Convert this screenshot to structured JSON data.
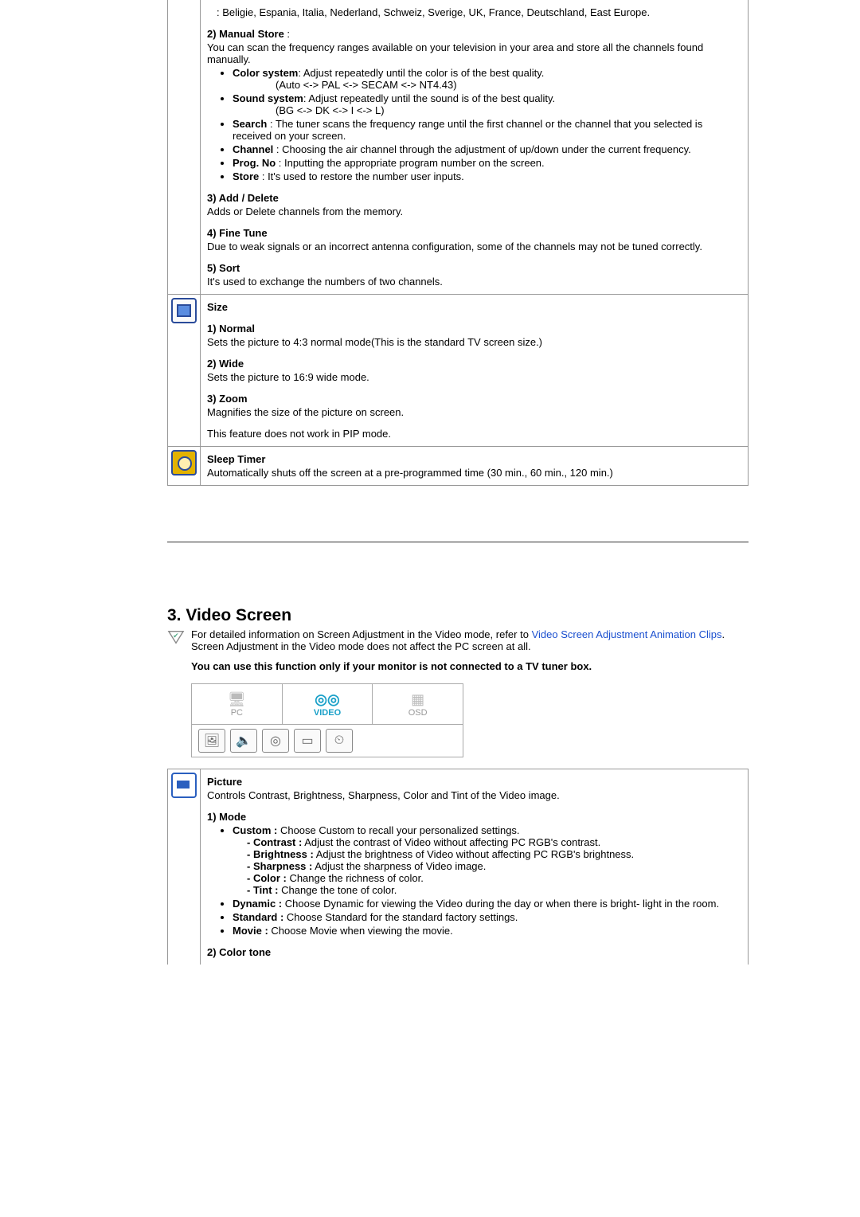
{
  "countries_line": ": Beligie, Espania, Italia, Nederland, Schweiz, Sverige, UK, France, Deutschland, East Europe.",
  "manual_store": {
    "title": "2) Manual Store",
    "colon": " :",
    "desc": "You can scan the frequency ranges available on your television in your area and store all the channels found manually.",
    "color_system_label": "Color system",
    "color_system_desc": ": Adjust repeatedly until the color is of the best quality.",
    "color_system_chain": "(Auto <-> PAL <-> SECAM <-> NT4.43)",
    "sound_system_label": "Sound system",
    "sound_system_desc": ": Adjust repeatedly until the sound is of the best quality.",
    "sound_system_chain": "(BG <-> DK <-> I <-> L)",
    "search_label": "Search",
    "search_desc": " : The tuner scans the frequency range until the first channel or the channel that you selected is received on your screen.",
    "channel_label": "Channel",
    "channel_desc": " : Choosing the air channel through the adjustment of up/down under the current frequency.",
    "progno_label": "Prog. No",
    "progno_desc": " : Inputting the appropriate program number on the screen.",
    "store_label": "Store",
    "store_desc": " : It's used to restore the number user inputs."
  },
  "add_delete": {
    "title": "3) Add / Delete",
    "desc": "Adds or Delete channels from the memory."
  },
  "fine_tune": {
    "title": "4) Fine Tune",
    "desc": "Due to weak signals or an incorrect antenna configuration, some of the channels may not be tuned correctly."
  },
  "sort": {
    "title": "5) Sort",
    "desc": "It's used to exchange the numbers of two channels."
  },
  "size": {
    "title": "Size",
    "normal_title": "1) Normal",
    "normal_desc": "Sets the picture to 4:3 normal mode(This is the standard TV screen size.)",
    "wide_title": "2) Wide",
    "wide_desc": "Sets the picture to 16:9 wide mode.",
    "zoom_title": "3) Zoom",
    "zoom_desc": "Magnifies the size of the picture on screen.",
    "note": "This feature does not work in PIP mode."
  },
  "sleep_timer": {
    "title": "Sleep Timer",
    "desc": "Automatically shuts off the screen at a pre-programmed time (30 min., 60 min., 120 min.)"
  },
  "video_section": {
    "heading": "3. Video Screen",
    "note1a": "For detailed information on Screen Adjustment in the Video mode, refer to ",
    "note1_link": "Video Screen Adjustment Animation Clips",
    "note1b": ". Screen Adjustment in the Video mode does not affect the PC screen at all.",
    "bold_note": "You can use this function only if your monitor is not connected to a TV tuner box.",
    "tabs": {
      "pc": "PC",
      "video": "VIDEO",
      "osd": "OSD"
    }
  },
  "picture": {
    "title": "Picture",
    "desc": "Controls Contrast, Brightness, Sharpness, Color and Tint of the Video image.",
    "mode_title": "1) Mode",
    "custom_label": "Custom :",
    "custom_desc": " Choose Custom to recall your personalized settings.",
    "contrast_label": "- Contrast :",
    "contrast_desc": " Adjust the contrast of Video without affecting PC RGB's contrast.",
    "brightness_label": "- Brightness :",
    "brightness_desc": " Adjust the brightness of Video without affecting PC RGB's brightness.",
    "sharpness_label": "- Sharpness :",
    "sharpness_desc": " Adjust the sharpness of Video image.",
    "color_label": "- Color :",
    "color_desc": " Change the richness of color.",
    "tint_label": "- Tint :",
    "tint_desc": " Change the tone of color.",
    "dynamic_label": "Dynamic :",
    "dynamic_desc": " Choose Dynamic for viewing the Video during the day or when there is bright- light in the room.",
    "standard_label": "Standard :",
    "standard_desc": " Choose Standard for the standard factory settings.",
    "movie_label": "Movie :",
    "movie_desc": " Choose Movie when viewing the movie.",
    "color_tone_title": "2) Color tone"
  }
}
